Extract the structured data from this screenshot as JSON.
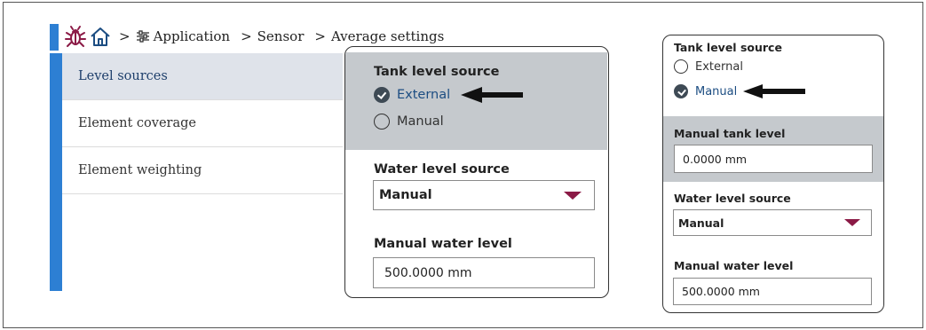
{
  "breadcrumb": {
    "app_label": "Application",
    "sensor_label": "Sensor",
    "average_label": "Average settings",
    "separator": ">"
  },
  "sidebar": {
    "items": [
      {
        "label": "Level sources",
        "active": true
      },
      {
        "label": "Element coverage",
        "active": false
      },
      {
        "label": "Element weighting",
        "active": false
      }
    ]
  },
  "panel_left": {
    "tank_source_label": "Tank level source",
    "options": [
      "External",
      "Manual"
    ],
    "selected": "External",
    "water_source_label": "Water level source",
    "water_source_value": "Manual",
    "manual_water_label": "Manual water level",
    "manual_water_value": "500.0000 mm"
  },
  "panel_right": {
    "tank_source_label": "Tank level source",
    "options": [
      "External",
      "Manual"
    ],
    "selected": "Manual",
    "manual_tank_label": "Manual tank level",
    "manual_tank_value": "0.0000 mm",
    "water_source_label": "Water level source",
    "water_source_value": "Manual",
    "manual_water_label": "Manual water level",
    "manual_water_value": "500.0000 mm"
  },
  "colors": {
    "accent_blue": "#2d7fd3",
    "caret": "#8b1a46",
    "gray_panel": "#c5c9cd",
    "bug_icon": "#8b1a46",
    "home_icon": "#1c4d82"
  }
}
